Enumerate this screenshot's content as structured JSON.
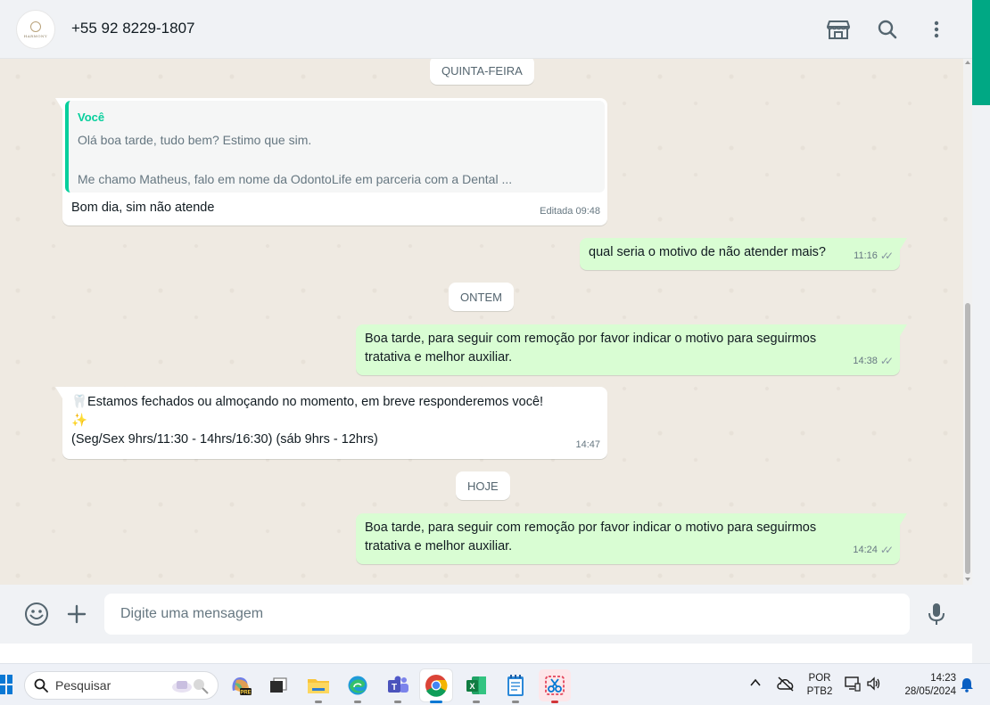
{
  "header": {
    "avatar_brand": "HARMONY",
    "contact_name": "+55 92 8229-1807",
    "icons": [
      "store-icon",
      "search-icon",
      "more-vertical-icon"
    ]
  },
  "chat": {
    "chips": {
      "thursday": "QUINTA-FEIRA",
      "yesterday": "ONTEM",
      "today": "HOJE"
    },
    "msg1": {
      "quote_author": "Você",
      "quote_line1": "Olá boa tarde, tudo bem? Estimo que sim.",
      "quote_line2": "Me chamo Matheus, falo em nome da OdontoLife em parceria com a Dental ...",
      "text": "Bom dia, sim não atende",
      "meta": "Editada 09:48"
    },
    "msg2": {
      "text": "qual seria o motivo de não atender mais?",
      "time": "11:16"
    },
    "msg3": {
      "line1": "Boa tarde, para seguir com remoção por favor indicar o motivo para seguirmos",
      "line2": "tratativa e melhor auxiliar.",
      "time": "14:38"
    },
    "msg4": {
      "line1": "🦷Estamos fechados  ou almoçando  no momento, em breve responderemos você!",
      "line2": "✨",
      "line3": "(Seg/Sex 9hrs/11:30 - 14hrs/16:30) (sáb 9hrs - 12hrs)",
      "time": "14:47"
    },
    "msg5": {
      "line1": "Boa tarde, para seguir com remoção por favor indicar o motivo para seguirmos",
      "line2": "tratativa e melhor auxiliar.",
      "time": "14:24"
    },
    "read_ticks": "✓✓"
  },
  "composer": {
    "placeholder": "Digite uma mensagem",
    "icons": [
      "emoji-icon",
      "plus-icon",
      "microphone-icon"
    ]
  },
  "taskbar": {
    "search_label": "Pesquisar",
    "apps": [
      "copilot-icon",
      "task-view-icon",
      "file-explorer-icon",
      "edge-icon",
      "teams-icon",
      "chrome-icon",
      "excel-icon",
      "notepad-icon",
      "snipping-tool-icon"
    ],
    "copilot_badge": "PRE",
    "lang_line1": "POR",
    "lang_line2": "PTB2",
    "time": "14:23",
    "date": "28/05/2024"
  },
  "colors": {
    "accent": "#00a884",
    "outgoing_bubble": "#d9fdd3",
    "incoming_bubble": "#ffffff",
    "chat_background": "#efeae2",
    "quote_author": "#06cf9c"
  }
}
